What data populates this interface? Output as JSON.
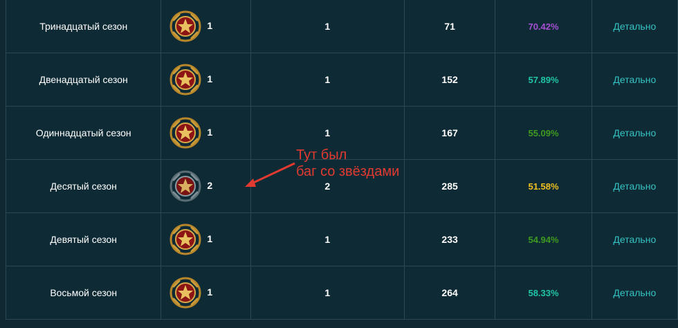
{
  "rows": [
    {
      "name": "Тринадцатый сезон",
      "rank": "1",
      "medal": "gold",
      "col3": "1",
      "col4": "71",
      "pct": "70.42%",
      "pct_color": "#a64fd4",
      "detail": "Детально"
    },
    {
      "name": "Двенадцатый сезон",
      "rank": "1",
      "medal": "gold",
      "col3": "1",
      "col4": "152",
      "pct": "57.89%",
      "pct_color": "#20c4a6",
      "detail": "Детально"
    },
    {
      "name": "Одиннадцатый сезон",
      "rank": "1",
      "medal": "gold",
      "col3": "1",
      "col4": "167",
      "pct": "55.09%",
      "pct_color": "#3e9a1e",
      "detail": "Детально"
    },
    {
      "name": "Десятый сезон",
      "rank": "2",
      "medal": "silver",
      "col3": "2",
      "col4": "285",
      "pct": "51.58%",
      "pct_color": "#f0c020",
      "detail": "Детально"
    },
    {
      "name": "Девятый сезон",
      "rank": "1",
      "medal": "gold",
      "col3": "1",
      "col4": "233",
      "pct": "54.94%",
      "pct_color": "#3e9a1e",
      "detail": "Детально"
    },
    {
      "name": "Восьмой сезон",
      "rank": "1",
      "medal": "gold",
      "col3": "1",
      "col4": "264",
      "pct": "58.33%",
      "pct_color": "#20c4a6",
      "detail": "Детально"
    }
  ],
  "annotation": {
    "line1": "Тут был",
    "line2": "баг со звёздами",
    "color": "#e23a30"
  }
}
